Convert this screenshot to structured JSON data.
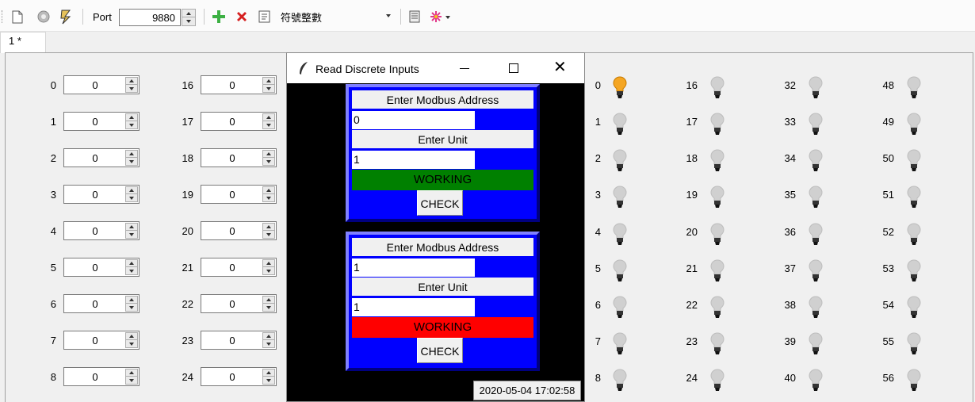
{
  "toolbar": {
    "port_label": "Port",
    "port_value": "9880",
    "format_label": "符號整數"
  },
  "tab": {
    "label": "1 *"
  },
  "registers": {
    "col1": [
      {
        "addr": "0",
        "value": "0"
      },
      {
        "addr": "1",
        "value": "0"
      },
      {
        "addr": "2",
        "value": "0"
      },
      {
        "addr": "3",
        "value": "0"
      },
      {
        "addr": "4",
        "value": "0"
      },
      {
        "addr": "5",
        "value": "0"
      },
      {
        "addr": "6",
        "value": "0"
      },
      {
        "addr": "7",
        "value": "0"
      },
      {
        "addr": "8",
        "value": "0"
      }
    ],
    "col2": [
      {
        "addr": "16",
        "value": "0"
      },
      {
        "addr": "17",
        "value": "0"
      },
      {
        "addr": "18",
        "value": "0"
      },
      {
        "addr": "19",
        "value": "0"
      },
      {
        "addr": "20",
        "value": "0"
      },
      {
        "addr": "21",
        "value": "0"
      },
      {
        "addr": "22",
        "value": "0"
      },
      {
        "addr": "23",
        "value": "0"
      },
      {
        "addr": "24",
        "value": "0"
      }
    ]
  },
  "discrete_inputs": {
    "col1": [
      "0",
      "1",
      "2",
      "3",
      "4",
      "5",
      "6",
      "7",
      "8"
    ],
    "col2": [
      "16",
      "17",
      "18",
      "19",
      "20",
      "21",
      "22",
      "23",
      "24"
    ],
    "col3": [
      "32",
      "33",
      "34",
      "35",
      "36",
      "37",
      "38",
      "39",
      "40"
    ],
    "col4": [
      "48",
      "49",
      "50",
      "51",
      "52",
      "53",
      "54",
      "55",
      "56"
    ],
    "lit": [
      "0"
    ]
  },
  "dialog": {
    "title": "Read Discrete Inputs",
    "panels": [
      {
        "address_label": "Enter Modbus Address",
        "address_value": "0",
        "unit_label": "Enter Unit",
        "unit_value": "1",
        "status": "WORKING",
        "status_color": "#008000",
        "button": "CHECK"
      },
      {
        "address_label": "Enter Modbus Address",
        "address_value": "1",
        "unit_label": "Enter Unit",
        "unit_value": "1",
        "status": "WORKING",
        "status_color": "#ff0000",
        "button": "CHECK"
      }
    ],
    "timestamp": "2020-05-04 17:02:58"
  },
  "colors": {
    "panel_blue": "#0000ff",
    "bulb_on": "#f5a623",
    "bulb_off": "#d0d0d0"
  }
}
